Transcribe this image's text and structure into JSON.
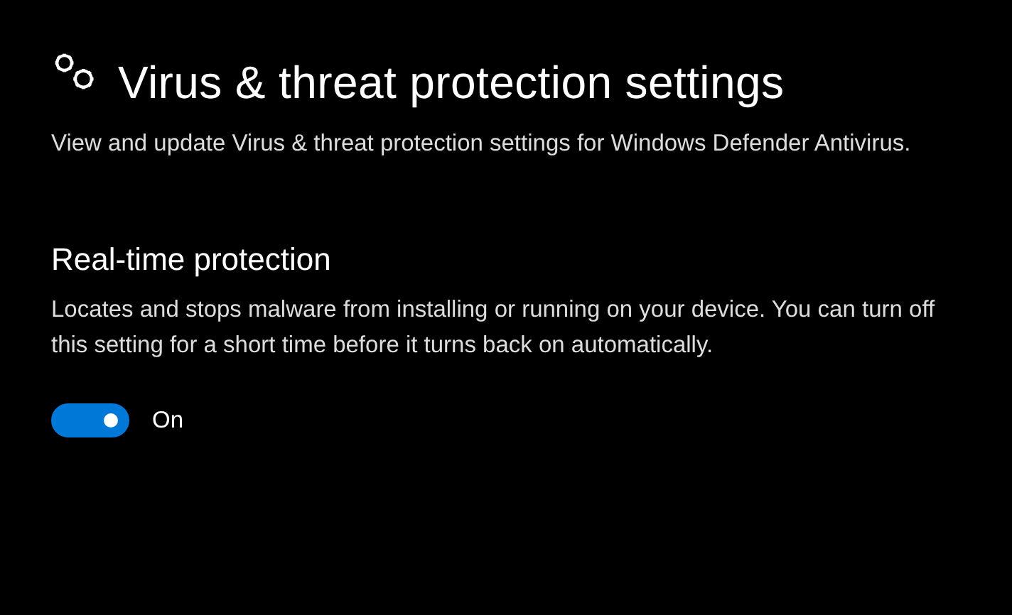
{
  "page": {
    "title": "Virus & threat protection settings",
    "description": "View and update Virus & threat protection settings for Windows Defender Antivirus."
  },
  "sections": [
    {
      "heading": "Real-time protection",
      "description": "Locates and stops malware from installing or running on your device. You can turn off this setting for a short time before it turns back on automatically.",
      "toggle": {
        "on": true,
        "label": "On"
      }
    }
  ]
}
